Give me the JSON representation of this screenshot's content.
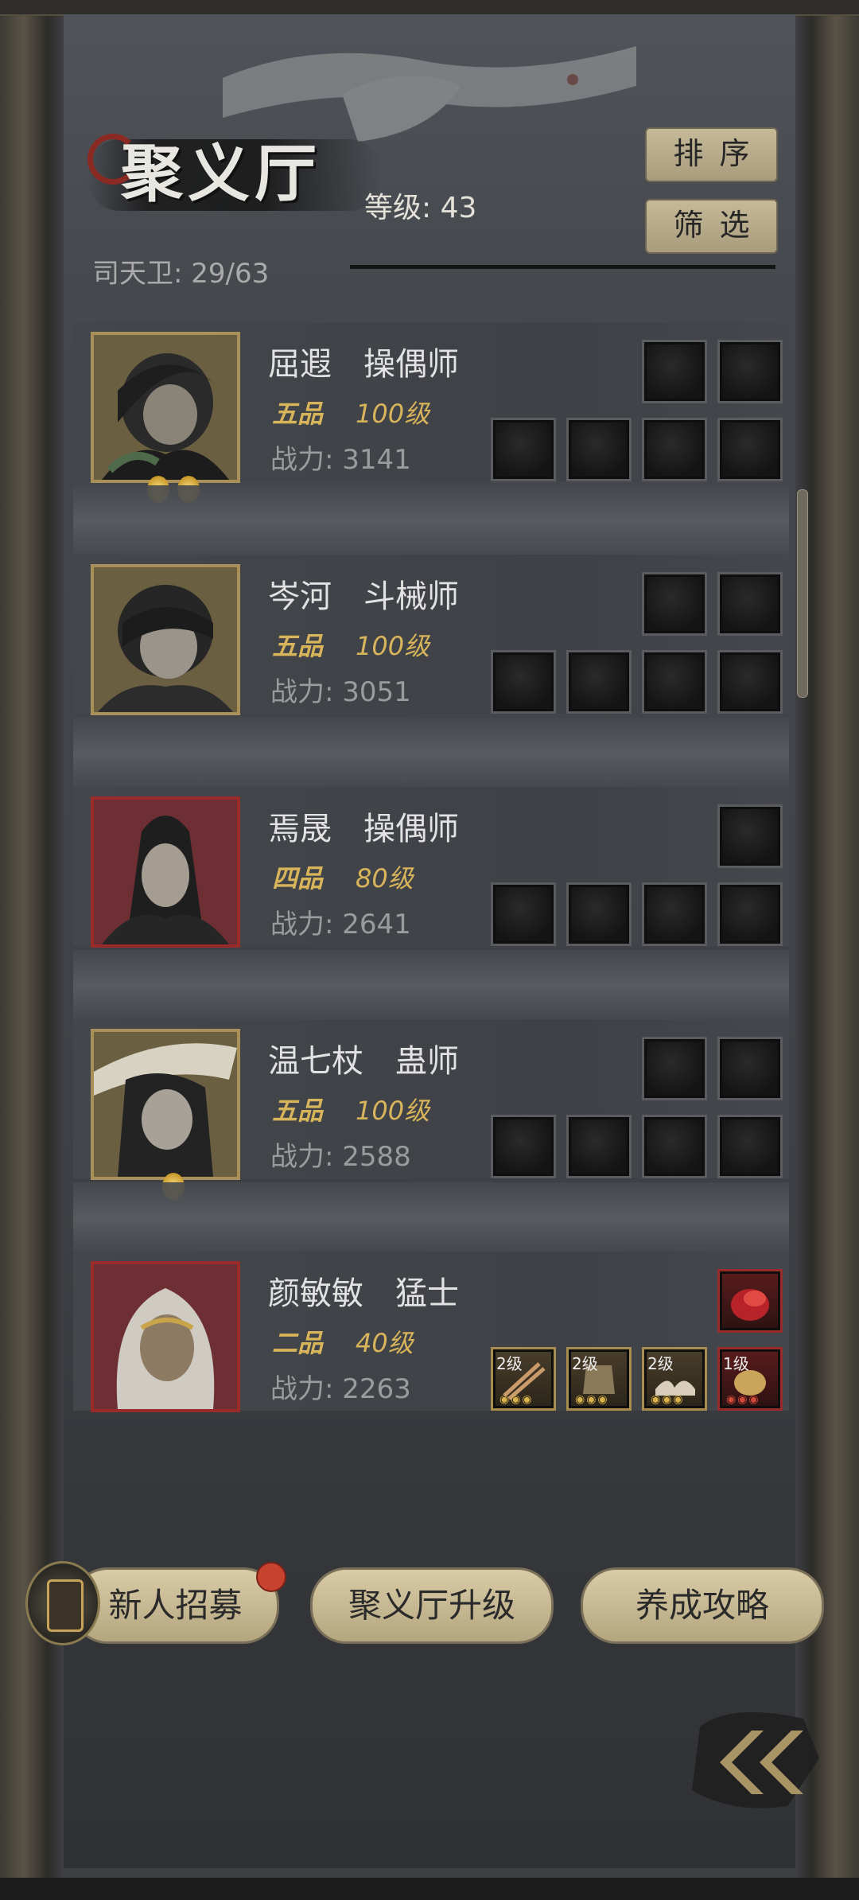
{
  "header": {
    "title": "聚义厅",
    "level_text": "等级: 43",
    "guards_text": "司天卫: 29/63",
    "sort_label": "排序",
    "filter_label": "筛选"
  },
  "heroes": [
    {
      "name": "屈遐　操偶师",
      "rank": "五品",
      "level": "100级",
      "power": "战力: 3141",
      "frame": "gold"
    },
    {
      "name": "岑河　斗械师",
      "rank": "五品",
      "level": "100级",
      "power": "战力: 3051",
      "frame": "gold"
    },
    {
      "name": "焉晟　操偶师",
      "rank": "四品",
      "level": "80级",
      "power": "战力: 2641",
      "frame": "red"
    },
    {
      "name": "温七杖　蛊师",
      "rank": "五品",
      "level": "100级",
      "power": "战力: 2588",
      "frame": "gold"
    },
    {
      "name": "颜敏敏　猛士",
      "rank": "二品",
      "level": "40级",
      "power": "战力: 2263",
      "frame": "red",
      "gear": [
        {
          "level": "2级"
        },
        {
          "level": "2级"
        },
        {
          "level": "2级"
        },
        {
          "level": "1级"
        }
      ]
    }
  ],
  "buttons": {
    "recruit": "新人招募",
    "upgrade": "聚义厅升级",
    "guide": "养成攻略"
  },
  "colors": {
    "gold": "#d8b45a",
    "panel": "#45484d",
    "button": "#c6b998",
    "frame_red": "#9a2b2b"
  },
  "icons": {
    "back": "double-chevron-left-icon"
  }
}
